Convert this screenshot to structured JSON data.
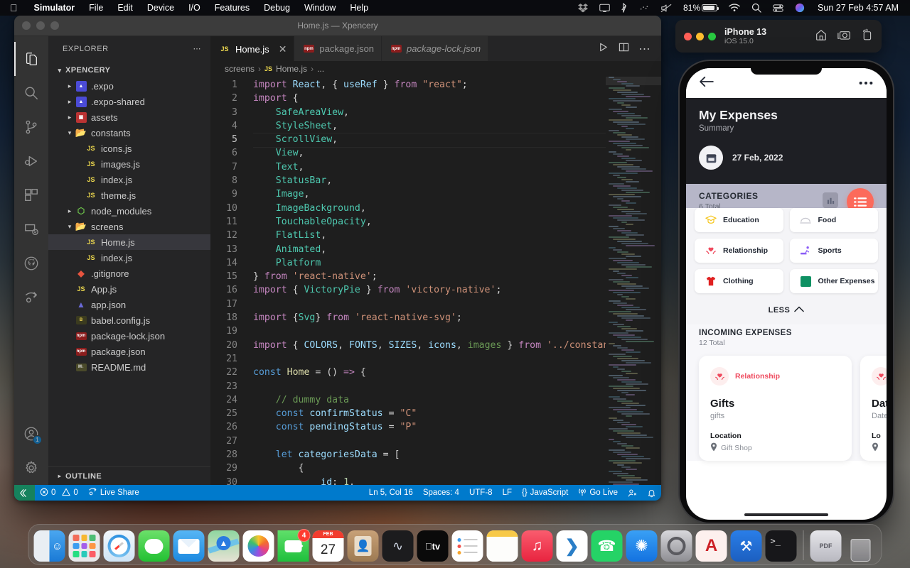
{
  "menubar": {
    "apple_icon": "apple-icon",
    "items": [
      {
        "label": "Simulator",
        "bold": true
      },
      {
        "label": "File",
        "bold": false
      },
      {
        "label": "Edit",
        "bold": false
      },
      {
        "label": "Device",
        "bold": false
      },
      {
        "label": "I/O",
        "bold": false
      },
      {
        "label": "Features",
        "bold": false
      },
      {
        "label": "Debug",
        "bold": false
      },
      {
        "label": "Window",
        "bold": false
      },
      {
        "label": "Help",
        "bold": false
      }
    ],
    "status_icons": [
      "dropbox-icon",
      "display-icon",
      "bluetooth-icon",
      "dots-icon",
      "volume-mute-icon"
    ],
    "battery_percent": "81%",
    "right_icons": [
      "wifi-icon",
      "search-icon",
      "control-center-icon",
      "siri-icon"
    ],
    "clock": "Sun 27 Feb  4:57 AM"
  },
  "vscode": {
    "window_title": "Home.js — Xpencery",
    "activity_bar": [
      {
        "name": "explorer-icon",
        "active": true
      },
      {
        "name": "search-icon",
        "active": false
      },
      {
        "name": "source-control-icon",
        "active": false
      },
      {
        "name": "run-and-debug-icon",
        "active": false
      },
      {
        "name": "extensions-icon",
        "active": false
      },
      {
        "name": "remote-explorer-icon",
        "active": false
      },
      {
        "name": "github-icon",
        "active": false
      },
      {
        "name": "live-share-icon",
        "active": false
      }
    ],
    "account_badge": "1",
    "sidebar": {
      "header": "EXPLORER",
      "more_icon": "ellipsis-icon",
      "root": "XPENCERY",
      "outline_label": "OUTLINE",
      "tree": [
        {
          "label": ".expo",
          "icon": "expo-folder-icon",
          "indent": 1,
          "chev": "›",
          "selected": false
        },
        {
          "label": ".expo-shared",
          "icon": "expo-folder-icon",
          "indent": 1,
          "chev": "›",
          "selected": false
        },
        {
          "label": "assets",
          "icon": "assets-folder-icon",
          "indent": 1,
          "chev": "›",
          "selected": false
        },
        {
          "label": "constants",
          "icon": "folder-open-icon",
          "indent": 1,
          "chev": "⌄",
          "selected": false
        },
        {
          "label": "icons.js",
          "icon": "js-file-icon",
          "indent": 2,
          "chev": "",
          "selected": false
        },
        {
          "label": "images.js",
          "icon": "js-file-icon",
          "indent": 2,
          "chev": "",
          "selected": false
        },
        {
          "label": "index.js",
          "icon": "js-file-icon",
          "indent": 2,
          "chev": "",
          "selected": false
        },
        {
          "label": "theme.js",
          "icon": "js-file-icon",
          "indent": 2,
          "chev": "",
          "selected": false
        },
        {
          "label": "node_modules",
          "icon": "node-folder-icon",
          "indent": 1,
          "chev": "›",
          "selected": false
        },
        {
          "label": "screens",
          "icon": "folder-open-icon",
          "indent": 1,
          "chev": "⌄",
          "selected": false
        },
        {
          "label": "Home.js",
          "icon": "js-file-icon",
          "indent": 2,
          "chev": "",
          "selected": true
        },
        {
          "label": "index.js",
          "icon": "js-file-icon",
          "indent": 2,
          "chev": "",
          "selected": false
        },
        {
          "label": ".gitignore",
          "icon": "git-file-icon",
          "indent": 1,
          "chev": "",
          "selected": false
        },
        {
          "label": "App.js",
          "icon": "js-file-icon",
          "indent": 1,
          "chev": "",
          "selected": false
        },
        {
          "label": "app.json",
          "icon": "expo-config-icon",
          "indent": 1,
          "chev": "",
          "selected": false
        },
        {
          "label": "babel.config.js",
          "icon": "babel-file-icon",
          "indent": 1,
          "chev": "",
          "selected": false
        },
        {
          "label": "package-lock.json",
          "icon": "npm-file-icon",
          "indent": 1,
          "chev": "",
          "selected": false
        },
        {
          "label": "package.json",
          "icon": "npm-file-icon",
          "indent": 1,
          "chev": "",
          "selected": false
        },
        {
          "label": "README.md",
          "icon": "markdown-file-icon",
          "indent": 1,
          "chev": "",
          "selected": false
        }
      ]
    },
    "tabs": [
      {
        "label": "Home.js",
        "icon": "js-file-icon",
        "active": true,
        "italic": false,
        "closable": true
      },
      {
        "label": "package.json",
        "icon": "npm-file-icon",
        "active": false,
        "italic": false,
        "closable": false
      },
      {
        "label": "package-lock.json",
        "icon": "npm-file-icon",
        "active": false,
        "italic": true,
        "closable": false
      }
    ],
    "tab_actions": [
      "run-icon",
      "split-editor-icon",
      "more-actions-icon"
    ],
    "breadcrumb": [
      "screens",
      "Home.js",
      "..."
    ],
    "code_lines": [
      {
        "n": 1,
        "tokens": [
          [
            "kw",
            "import "
          ],
          [
            "id",
            "React"
          ],
          [
            "pun",
            ", { "
          ],
          [
            "id",
            "useRef"
          ],
          [
            "pun",
            " } "
          ],
          [
            "kw",
            "from "
          ],
          [
            "str",
            "\"react\""
          ],
          [
            "pun",
            ";"
          ]
        ]
      },
      {
        "n": 2,
        "tokens": [
          [
            "kw",
            "import "
          ],
          [
            "pun",
            "{"
          ]
        ]
      },
      {
        "n": 3,
        "tokens": [
          [
            "pun",
            "    "
          ],
          [
            "cls",
            "SafeAreaView"
          ],
          [
            "pun",
            ","
          ]
        ]
      },
      {
        "n": 4,
        "tokens": [
          [
            "pun",
            "    "
          ],
          [
            "cls",
            "StyleSheet"
          ],
          [
            "pun",
            ","
          ]
        ]
      },
      {
        "n": 5,
        "tokens": [
          [
            "pun",
            "    "
          ],
          [
            "cls",
            "ScrollView"
          ],
          [
            "pun",
            ","
          ]
        ],
        "highlight": true
      },
      {
        "n": 6,
        "tokens": [
          [
            "pun",
            "    "
          ],
          [
            "cls",
            "View"
          ],
          [
            "pun",
            ","
          ]
        ]
      },
      {
        "n": 7,
        "tokens": [
          [
            "pun",
            "    "
          ],
          [
            "cls",
            "Text"
          ],
          [
            "pun",
            ","
          ]
        ]
      },
      {
        "n": 8,
        "tokens": [
          [
            "pun",
            "    "
          ],
          [
            "cls",
            "StatusBar"
          ],
          [
            "pun",
            ","
          ]
        ]
      },
      {
        "n": 9,
        "tokens": [
          [
            "pun",
            "    "
          ],
          [
            "cls",
            "Image"
          ],
          [
            "pun",
            ","
          ]
        ]
      },
      {
        "n": 10,
        "tokens": [
          [
            "pun",
            "    "
          ],
          [
            "cls",
            "ImageBackground"
          ],
          [
            "pun",
            ","
          ]
        ]
      },
      {
        "n": 11,
        "tokens": [
          [
            "pun",
            "    "
          ],
          [
            "cls",
            "TouchableOpacity"
          ],
          [
            "pun",
            ","
          ]
        ]
      },
      {
        "n": 12,
        "tokens": [
          [
            "pun",
            "    "
          ],
          [
            "cls",
            "FlatList"
          ],
          [
            "pun",
            ","
          ]
        ]
      },
      {
        "n": 13,
        "tokens": [
          [
            "pun",
            "    "
          ],
          [
            "cls",
            "Animated"
          ],
          [
            "pun",
            ","
          ]
        ]
      },
      {
        "n": 14,
        "tokens": [
          [
            "pun",
            "    "
          ],
          [
            "cls",
            "Platform"
          ]
        ]
      },
      {
        "n": 15,
        "tokens": [
          [
            "pun",
            "} "
          ],
          [
            "kw",
            "from "
          ],
          [
            "str",
            "'react-native'"
          ],
          [
            "pun",
            ";"
          ]
        ]
      },
      {
        "n": 16,
        "tokens": [
          [
            "kw",
            "import "
          ],
          [
            "pun",
            "{ "
          ],
          [
            "cls",
            "VictoryPie"
          ],
          [
            "pun",
            " } "
          ],
          [
            "kw",
            "from "
          ],
          [
            "str",
            "'victory-native'"
          ],
          [
            "pun",
            ";"
          ]
        ]
      },
      {
        "n": 17,
        "tokens": []
      },
      {
        "n": 18,
        "tokens": [
          [
            "kw",
            "import "
          ],
          [
            "pun",
            "{"
          ],
          [
            "cls",
            "Svg"
          ],
          [
            "pun",
            "} "
          ],
          [
            "kw",
            "from "
          ],
          [
            "str",
            "'react-native-svg'"
          ],
          [
            "pun",
            ";"
          ]
        ]
      },
      {
        "n": 19,
        "tokens": []
      },
      {
        "n": 20,
        "tokens": [
          [
            "kw",
            "import "
          ],
          [
            "pun",
            "{ "
          ],
          [
            "id",
            "COLORS"
          ],
          [
            "pun",
            ", "
          ],
          [
            "id",
            "FONTS"
          ],
          [
            "pun",
            ", "
          ],
          [
            "id",
            "SIZES"
          ],
          [
            "pun",
            ", "
          ],
          [
            "id",
            "icons"
          ],
          [
            "pun",
            ", "
          ],
          [
            "cmt",
            "images"
          ],
          [
            "pun",
            " } "
          ],
          [
            "kw",
            "from "
          ],
          [
            "str",
            "'../constan"
          ]
        ]
      },
      {
        "n": 21,
        "tokens": []
      },
      {
        "n": 22,
        "tokens": [
          [
            "kw2",
            "const "
          ],
          [
            "fn",
            "Home"
          ],
          [
            "pun",
            " = () "
          ],
          [
            "kw",
            "=> "
          ],
          [
            "pun",
            "{"
          ]
        ]
      },
      {
        "n": 23,
        "tokens": []
      },
      {
        "n": 24,
        "tokens": [
          [
            "pun",
            "    "
          ],
          [
            "cmt",
            "// dummy data"
          ]
        ]
      },
      {
        "n": 25,
        "tokens": [
          [
            "pun",
            "    "
          ],
          [
            "kw2",
            "const "
          ],
          [
            "id",
            "confirmStatus"
          ],
          [
            "pun",
            " = "
          ],
          [
            "str",
            "\"C\""
          ]
        ]
      },
      {
        "n": 26,
        "tokens": [
          [
            "pun",
            "    "
          ],
          [
            "kw2",
            "const "
          ],
          [
            "id",
            "pendingStatus"
          ],
          [
            "pun",
            " = "
          ],
          [
            "str",
            "\"P\""
          ]
        ]
      },
      {
        "n": 27,
        "tokens": []
      },
      {
        "n": 28,
        "tokens": [
          [
            "pun",
            "    "
          ],
          [
            "kw2",
            "let "
          ],
          [
            "id",
            "categoriesData"
          ],
          [
            "pun",
            " = ["
          ]
        ]
      },
      {
        "n": 29,
        "tokens": [
          [
            "pun",
            "        {"
          ]
        ]
      },
      {
        "n": 30,
        "tokens": [
          [
            "pun",
            "            "
          ],
          [
            "id",
            "id"
          ],
          [
            "pun",
            ": "
          ],
          [
            "num",
            "1"
          ],
          [
            "pun",
            ","
          ]
        ]
      }
    ],
    "statusbar": {
      "remote_icon": "remote-window-icon",
      "errors_icon": "error-icon",
      "errors": "0",
      "warnings_icon": "warning-icon",
      "warnings": "0",
      "live_share": "Live Share",
      "cursor": "Ln 5, Col 16",
      "spaces": "Spaces: 4",
      "encoding": "UTF-8",
      "eol": "LF",
      "language": "JavaScript",
      "go_live": "Go Live",
      "right_icons": [
        "feedback-icon",
        "notifications-icon"
      ]
    }
  },
  "simulator": {
    "device_name": "iPhone 13",
    "os_version": "iOS 15.0",
    "chrome_actions": [
      "home-icon",
      "screenshot-icon",
      "rotate-icon"
    ],
    "app": {
      "nav": {
        "back_icon": "back-arrow-icon",
        "more_icon": "ellipsis-icon"
      },
      "title": "My Expenses",
      "subtitle": "Summary",
      "date_icon": "calendar-icon",
      "date": "27 Feb, 2022",
      "categories": {
        "heading": "CATEGORIES",
        "total": "6 Total",
        "chart_icon": "bar-chart-icon",
        "list_icon": "list-icon",
        "items": [
          {
            "label": "Education",
            "color": "#f5c518",
            "icon": "education-icon"
          },
          {
            "label": "Food",
            "color": "#c8c8d0",
            "icon": "food-icon"
          },
          {
            "label": "Relationship",
            "color": "#ef4a5e",
            "icon": "relationship-icon"
          },
          {
            "label": "Sports",
            "color": "#8b5cf6",
            "icon": "sports-icon"
          },
          {
            "label": "Clothing",
            "color": "#e02020",
            "icon": "clothing-icon"
          },
          {
            "label": "Other Expenses",
            "color": "#0e9163",
            "icon": "other-icon"
          }
        ],
        "less_label": "LESS",
        "less_icon": "chevron-up-icon"
      },
      "incoming": {
        "heading": "INCOMING EXPENSES",
        "total": "12 Total",
        "cards": [
          {
            "category": "Relationship",
            "category_color": "#ef4a5e",
            "title": "Gifts",
            "description": "gifts",
            "location_label": "Location",
            "location": "Gift Shop",
            "location_icon": "map-pin-icon"
          },
          {
            "category": "Relationship",
            "category_color": "#ef4a5e",
            "title": "Date",
            "description": "Date",
            "location_label": "Lo",
            "location": "",
            "location_icon": "map-pin-icon"
          }
        ]
      }
    }
  },
  "dock": {
    "apps": [
      {
        "name": "finder",
        "running": true
      },
      {
        "name": "launchpad",
        "running": false
      },
      {
        "name": "safari",
        "running": true
      },
      {
        "name": "messages",
        "running": false
      },
      {
        "name": "mail",
        "running": true
      },
      {
        "name": "maps",
        "running": false
      },
      {
        "name": "photos",
        "running": false
      },
      {
        "name": "facetime",
        "running": false,
        "badge": "4"
      },
      {
        "name": "calendar",
        "running": false,
        "month": "FEB",
        "day": "27"
      },
      {
        "name": "contacts",
        "running": false
      },
      {
        "name": "podcasts",
        "running": false
      },
      {
        "name": "apple-tv",
        "running": false
      },
      {
        "name": "reminders",
        "running": false
      },
      {
        "name": "notes",
        "running": false
      },
      {
        "name": "music",
        "running": true
      },
      {
        "name": "vscode",
        "running": true
      },
      {
        "name": "whatsapp",
        "running": false
      },
      {
        "name": "app-store",
        "running": false
      },
      {
        "name": "system-preferences",
        "running": false
      },
      {
        "name": "acrobat",
        "running": false
      },
      {
        "name": "xcode",
        "running": true
      },
      {
        "name": "terminal",
        "running": true
      }
    ],
    "extras": [
      {
        "name": "downloads-stack"
      },
      {
        "name": "trash"
      }
    ]
  }
}
